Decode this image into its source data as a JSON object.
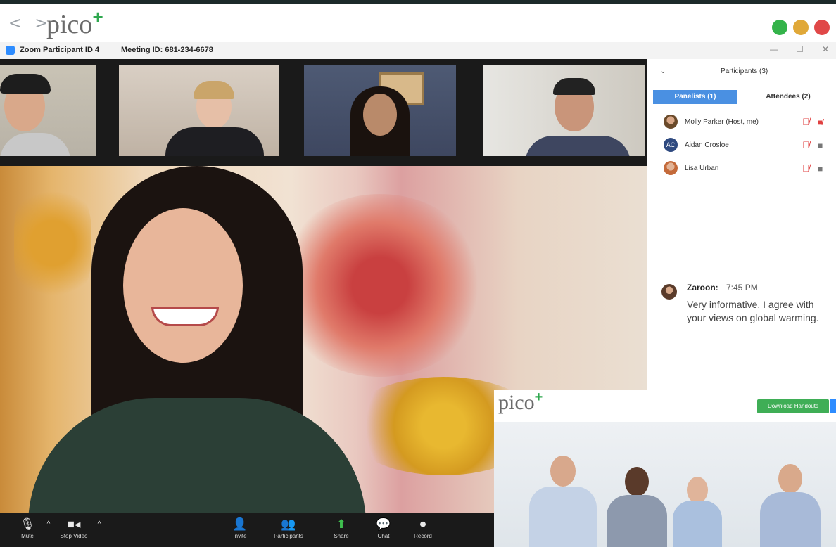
{
  "browser": {
    "nav_arrows": "< >",
    "brand": "pico",
    "brand_plus": "+",
    "window_dots": [
      "#34b34a",
      "#e0a838",
      "#e04848"
    ]
  },
  "window": {
    "title": "Zoom Participant ID 4",
    "meeting_id": "Meeting ID: 681-234-6678",
    "controls": [
      "—",
      "☐",
      "✕"
    ]
  },
  "controls": [
    {
      "label": "Mute",
      "icon": "microphone-icon",
      "glyph": "🎙"
    },
    {
      "label": "Stop Video",
      "icon": "video-camera-icon",
      "glyph": "■◂"
    },
    {
      "label": "Invite",
      "icon": "invite-icon",
      "glyph": "👤"
    },
    {
      "label": "Participants",
      "icon": "participants-icon",
      "glyph": "👥"
    },
    {
      "label": "Share",
      "icon": "share-screen-icon",
      "glyph": "⬆"
    },
    {
      "label": "Chat",
      "icon": "chat-icon",
      "glyph": "💬"
    },
    {
      "label": "Record",
      "icon": "record-icon",
      "glyph": "⏺"
    }
  ],
  "panel": {
    "title": "Participants (3)",
    "tabs": [
      "Panelists (1)",
      "Attendees (2)"
    ],
    "participants": [
      {
        "name": "Molly Parker (Host, me)",
        "initials": "",
        "avatar_color": "#8a6a4a"
      },
      {
        "name": "Aidan Crosloe",
        "initials": "AC",
        "avatar_color": "#2f4a80"
      },
      {
        "name": "Lisa Urban",
        "initials": "",
        "avatar_color": "#c46a3a"
      }
    ],
    "chat": {
      "sender": "Zaroon:",
      "time": "7:45 PM",
      "message": "Very informative. I agree with your views on global warming."
    }
  },
  "overlay": {
    "brand": "pico",
    "brand_plus": "+",
    "button": "Download Handouts"
  }
}
